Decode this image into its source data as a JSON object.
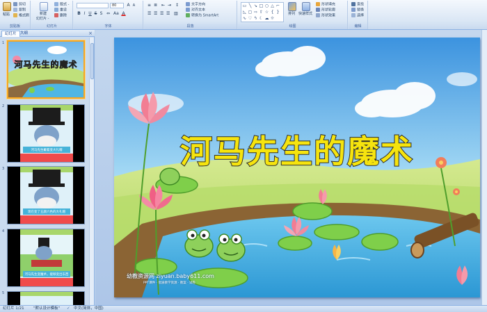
{
  "ribbon": {
    "groups": {
      "clipboard": "剪贴板",
      "slides": "幻灯片",
      "font": "字体",
      "paragraph": "段落",
      "drawing": "绘图",
      "editing": "编辑"
    },
    "clipboard": {
      "paste": "粘贴",
      "cut": "剪切",
      "copy": "复制",
      "format_painter": "格式刷"
    },
    "slides": {
      "new_slide": "新建",
      "new_slide_sub": "幻灯片 -",
      "layout": "版式 -",
      "reset": "重设",
      "delete": "删除"
    },
    "font": {
      "font_name": "",
      "font_size": "80"
    },
    "paragraph": {
      "text_direction": "文字方向",
      "align_text": "对齐文本",
      "smartart": "转换为 SmartArt"
    },
    "drawing": {
      "arrange": "排列",
      "quick_styles": "快速样式",
      "shape_fill": "形状填充",
      "shape_outline": "形状轮廓",
      "shape_effects": "形状效果"
    },
    "editing": {
      "find": "查找",
      "replace": "替换",
      "select": "选择"
    }
  },
  "pane": {
    "tabs": [
      "幻灯片",
      "大纲"
    ],
    "close": "×",
    "slides": [
      {
        "num": "1",
        "caption": "河马先生的魔术"
      },
      {
        "num": "2",
        "caption": "河马先生戴着变大礼帽"
      },
      {
        "num": "3",
        "caption": "现在变了五颜六色的大礼帽"
      },
      {
        "num": "4",
        "caption": "河马先生变魔术，能够变出东西"
      },
      {
        "num": "5",
        "caption": ""
      }
    ]
  },
  "slide": {
    "title": "河马先生的魔术",
    "watermark": "幼教资源网 ziyuan.baby611.com",
    "watermark_sub": "PPT课件 · 优质教学资源 · 教案 · 试卷"
  },
  "status": {
    "slide_pos": "幻灯片 1/21",
    "theme": "\"默认设计模板\"",
    "language": "中文(简体，中国)"
  },
  "colors": {
    "ribbon_bg": "#dbe7f5",
    "selection_border": "#f5a623",
    "title_fill": "#f6e40e"
  }
}
